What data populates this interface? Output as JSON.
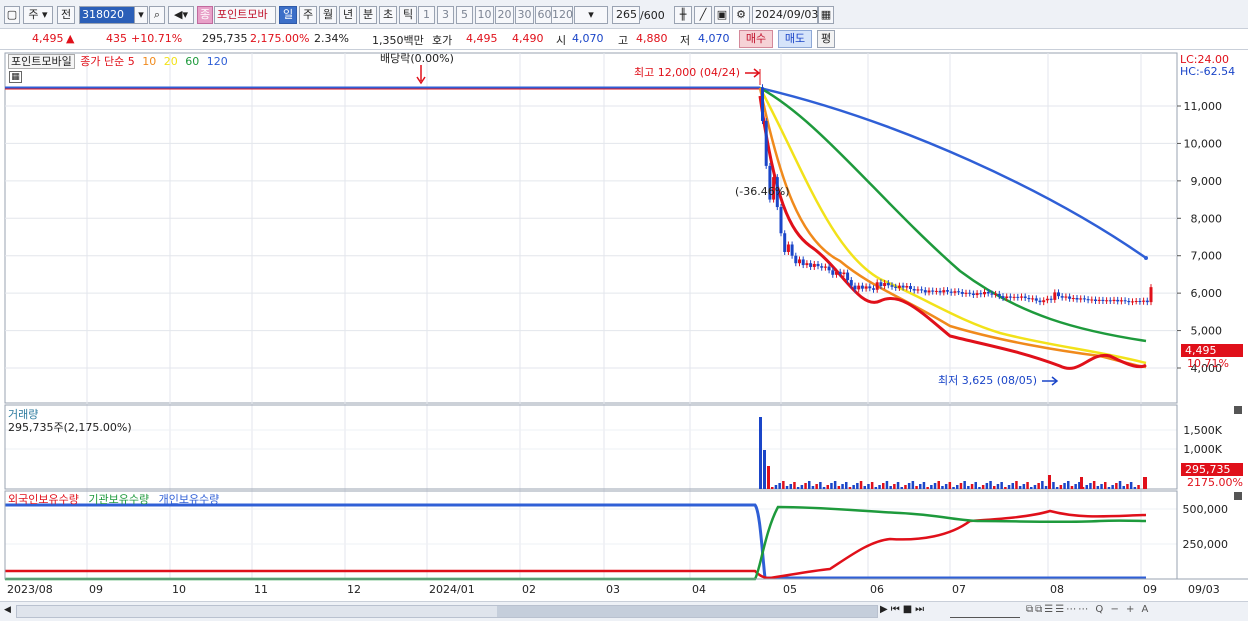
{
  "toolbar": {
    "type_label": "주",
    "prev_label": "전",
    "code": "318020",
    "name_badge": "종",
    "stock_name": "포인트모바",
    "period_day": "일",
    "period_week": "주",
    "period_month": "월",
    "period_year": "년",
    "period_min": "분",
    "period_sec": "초",
    "period_tick": "틱",
    "intervals": [
      "1",
      "3",
      "5",
      "10",
      "20",
      "30",
      "60",
      "120"
    ],
    "count": "265",
    "count_total": "/600",
    "date": "2024/09/03"
  },
  "quote": {
    "price": "4,495",
    "up_arrow": "▲",
    "change": "435",
    "change_pct": "+10.71%",
    "volume": "295,735",
    "volume_pct": "2,175.00%",
    "turnover": "2.34%",
    "amount": "1,350백만",
    "ask_label": "호가",
    "ask": "4,495",
    "bid": "4,490",
    "open_label": "시",
    "open": "4,070",
    "high_label": "고",
    "high": "4,880",
    "low_label": "저",
    "low": "4,070",
    "buy_btn": "매수",
    "sell_btn": "매도",
    "eval_btn": "평"
  },
  "price_panel": {
    "legend_name": "포인트모바일",
    "legend_ma_title": "종가 단순",
    "ma_periods": [
      "5",
      "10",
      "20",
      "60",
      "120"
    ],
    "ma_colors": [
      "#e0101a",
      "#f08a1c",
      "#f2e21a",
      "#1e9a3c",
      "#2f5fd6"
    ],
    "lc": "LC:24.00",
    "hc": "HC:-62.54",
    "dividend": "배당락(0.00%)",
    "max_note": "최고 12,000 (04/24)",
    "min_note": "최저 3,625 (08/05)",
    "drop_note": "(-36.46%)",
    "y_ticks": [
      "11,000",
      "10,000",
      "9,000",
      "8,000",
      "7,000",
      "6,000",
      "5,000",
      "4,000"
    ],
    "last_price_tag": "4,495",
    "last_pct_tag": "10.71%"
  },
  "volume_panel": {
    "title": "거래량",
    "value": "295,735주(2,175.00%)",
    "y_ticks": [
      "1,500K",
      "1,000K"
    ],
    "last_tag": "295,735",
    "last_pct_tag": "2175.00%"
  },
  "holdings_panel": {
    "series_foreign": "외국인보유수량",
    "series_inst": "기관보유수량",
    "series_indiv": "개인보유수량",
    "y_ticks": [
      "500,000",
      "250,000"
    ]
  },
  "x_axis": [
    "2023/08",
    "09",
    "10",
    "11",
    "12",
    "2024/01",
    "02",
    "03",
    "04",
    "05",
    "06",
    "07",
    "08",
    "09",
    "09/03"
  ],
  "colors": {
    "up": "#e0101a",
    "down": "#1a45c8",
    "accent": "#2b5fb8"
  }
}
